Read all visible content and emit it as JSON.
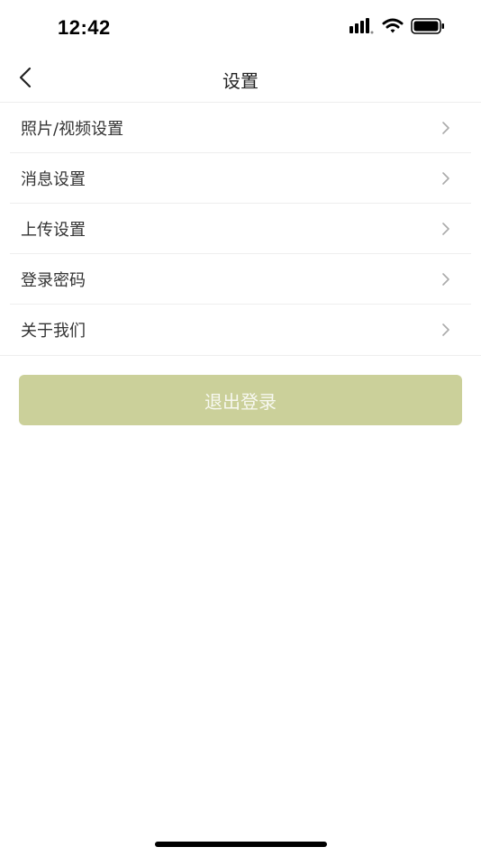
{
  "status_bar": {
    "time": "12:42",
    "icons": [
      "signal-icon",
      "wifi-icon",
      "battery-icon"
    ]
  },
  "nav": {
    "title": "设置",
    "back_icon": "chevron-left-icon"
  },
  "settings": {
    "items": [
      {
        "label": "照片/视频设置"
      },
      {
        "label": "消息设置"
      },
      {
        "label": "上传设置"
      },
      {
        "label": "登录密码"
      },
      {
        "label": "关于我们"
      }
    ],
    "chevron_icon": "chevron-right-icon"
  },
  "logout": {
    "label": "退出登录",
    "background": "#cbd09a"
  }
}
